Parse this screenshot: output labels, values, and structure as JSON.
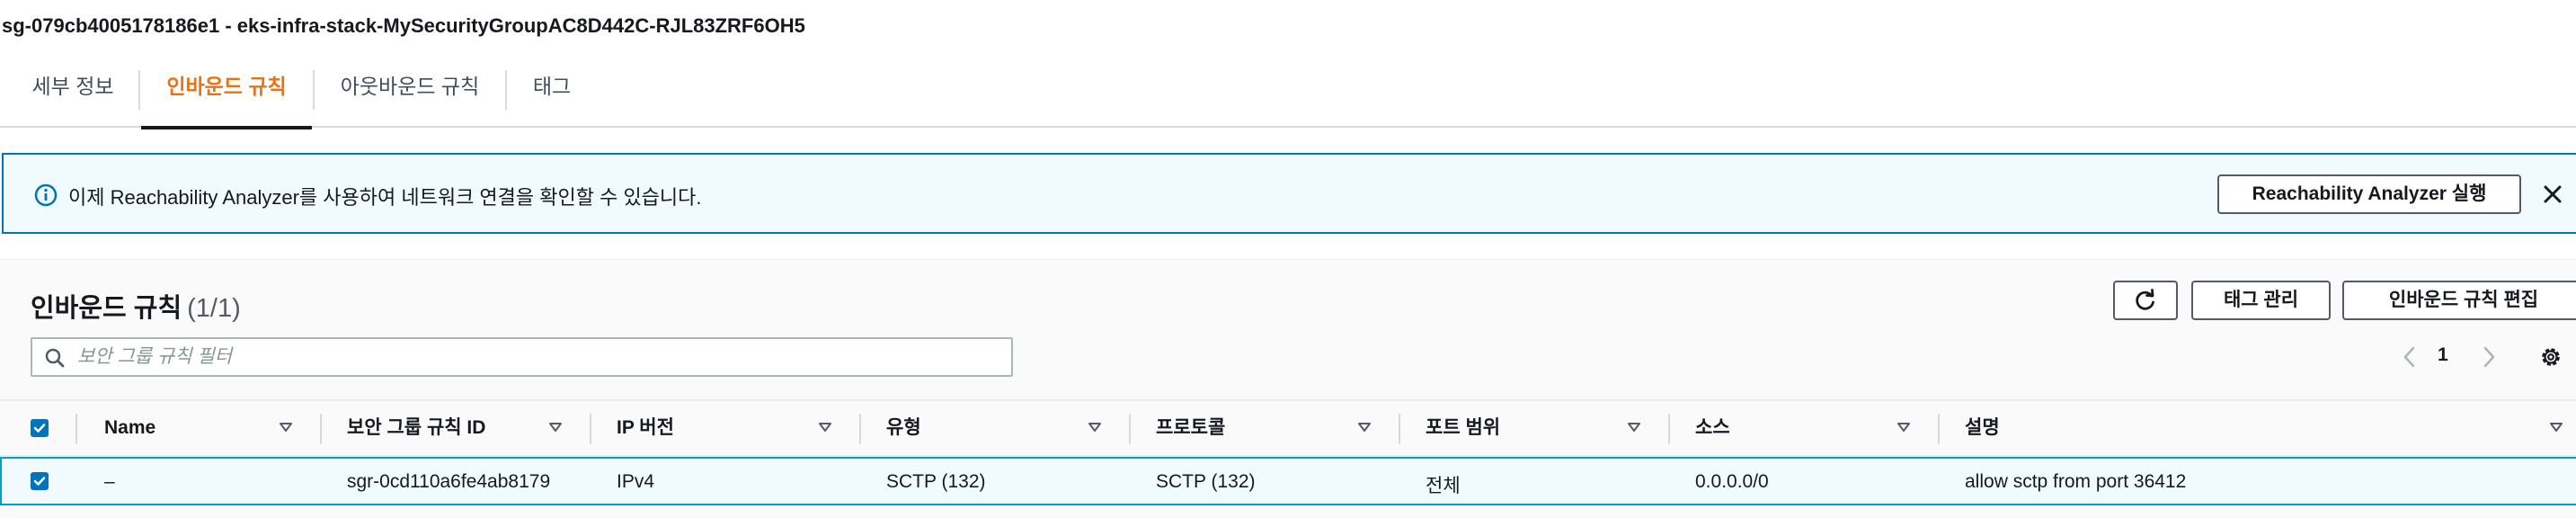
{
  "security_group": {
    "title": "sg-079cb4005178186e1 - eks-infra-stack-MySecurityGroupAC8D442C-RJL83ZRF6OH5"
  },
  "tabs": [
    {
      "label": "세부 정보",
      "active": false
    },
    {
      "label": "인바운드 규칙",
      "active": true
    },
    {
      "label": "아웃바운드 규칙",
      "active": false
    },
    {
      "label": "태그",
      "active": false
    }
  ],
  "banner": {
    "icon": "info-icon",
    "text": "이제 Reachability Analyzer를 사용하여 네트워크 연결을 확인할 수 있습니다.",
    "button_label": "Reachability Analyzer 실행",
    "close_icon": "close-icon"
  },
  "rules_panel": {
    "title": "인바운드 규칙",
    "count": "(1/1)",
    "refresh_icon": "refresh-icon",
    "manage_tags_label": "태그 관리",
    "edit_rules_label": "인바운드 규칙 편집",
    "filter_placeholder": "보안 그룹 규칙 필터",
    "filter_value": "",
    "current_page": "1"
  },
  "table": {
    "columns": [
      "Name",
      "보안 그룹 규칙 ID",
      "IP 버전",
      "유형",
      "프로토콜",
      "포트 범위",
      "소스",
      "설명"
    ],
    "all_selected": true,
    "rows": [
      {
        "selected": true,
        "name": "–",
        "rule_id": "sgr-0cd110a6fe4ab8179",
        "ip_version": "IPv4",
        "type": "SCTP (132)",
        "protocol": "SCTP (132)",
        "port_range": "전체",
        "source": "0.0.0.0/0",
        "description": "allow sctp from port 36412"
      }
    ]
  },
  "colors": {
    "accent_orange": "#ec7211",
    "info_blue": "#0073bb",
    "selection_border": "#00a1c9",
    "selection_bg": "#f1faff"
  }
}
